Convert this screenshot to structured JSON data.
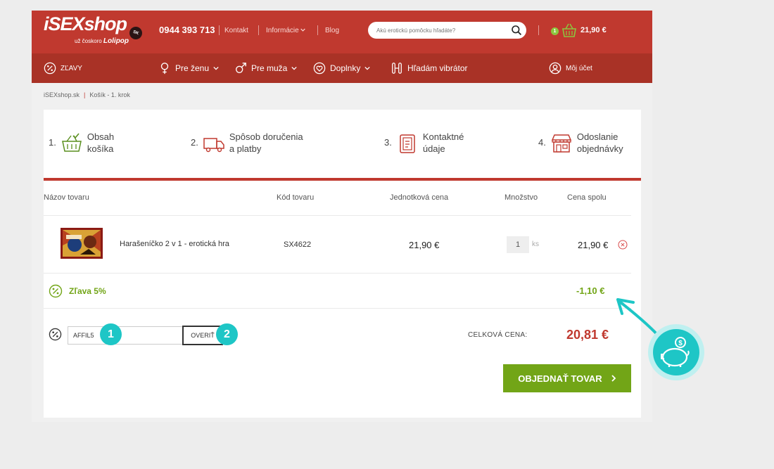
{
  "header": {
    "logo_text": "iSEXshop",
    "logo_badge": "SK",
    "logo_tagline_prefix": "už čoskoro",
    "logo_tagline_brand": "Lolipop",
    "phone": "0944 393 713",
    "links": [
      {
        "label": "Kontakt"
      },
      {
        "label": "Informácie"
      },
      {
        "label": "Blog"
      }
    ],
    "search_placeholder": "Akú erotickú pomôcku hľadáte?",
    "cart_count": "1",
    "cart_total": "21,90 €"
  },
  "nav": {
    "items": [
      {
        "label": "ZĽAVY",
        "icon": "discount-icon"
      },
      {
        "label": "Pre ženu",
        "icon": "female-icon"
      },
      {
        "label": "Pre muža",
        "icon": "male-icon"
      },
      {
        "label": "Doplnky",
        "icon": "heart-icon"
      },
      {
        "label": "Hľadám vibrátor",
        "icon": "vibrator-icon"
      },
      {
        "label": "Môj účet",
        "icon": "user-icon"
      }
    ]
  },
  "breadcrumb": [
    "iSEXshop.sk",
    "Košík - 1. krok"
  ],
  "steps": [
    {
      "num": "1.",
      "line1": "Obsah",
      "line2": "košíka",
      "icon": "basket-icon"
    },
    {
      "num": "2.",
      "line1": "Spôsob doručenia",
      "line2": "a platby",
      "icon": "truck-icon"
    },
    {
      "num": "3.",
      "line1": "Kontaktné",
      "line2": "údaje",
      "icon": "contact-form-icon"
    },
    {
      "num": "4.",
      "line1": "Odoslanie",
      "line2": "objednávky",
      "icon": "store-icon"
    }
  ],
  "table": {
    "headers": [
      "Názov tovaru",
      "Kód tovaru",
      "Jednotková cena",
      "Množstvo",
      "Cena spolu"
    ],
    "rows": [
      {
        "name": "Harašeníčko 2 v 1 - erotická hra",
        "code": "SX4622",
        "unit_price": "21,90 €",
        "qty": "1",
        "qty_unit": "ks",
        "total": "21,90 €"
      }
    ]
  },
  "discount": {
    "label": "Zľava 5%",
    "amount": "-1,10 €"
  },
  "coupon": {
    "value": "AFFIL5",
    "button": "OVERIŤ",
    "marker1": "1",
    "marker2": "2"
  },
  "total": {
    "label": "CELKOVÁ CENA:",
    "value": "20,81 €"
  },
  "order_button": "OBJEDNAŤ TOVAR",
  "colors": {
    "brand_red": "#c0392f",
    "nav_red": "#a93226",
    "green": "#72a517",
    "teal": "#1ec6c6"
  }
}
